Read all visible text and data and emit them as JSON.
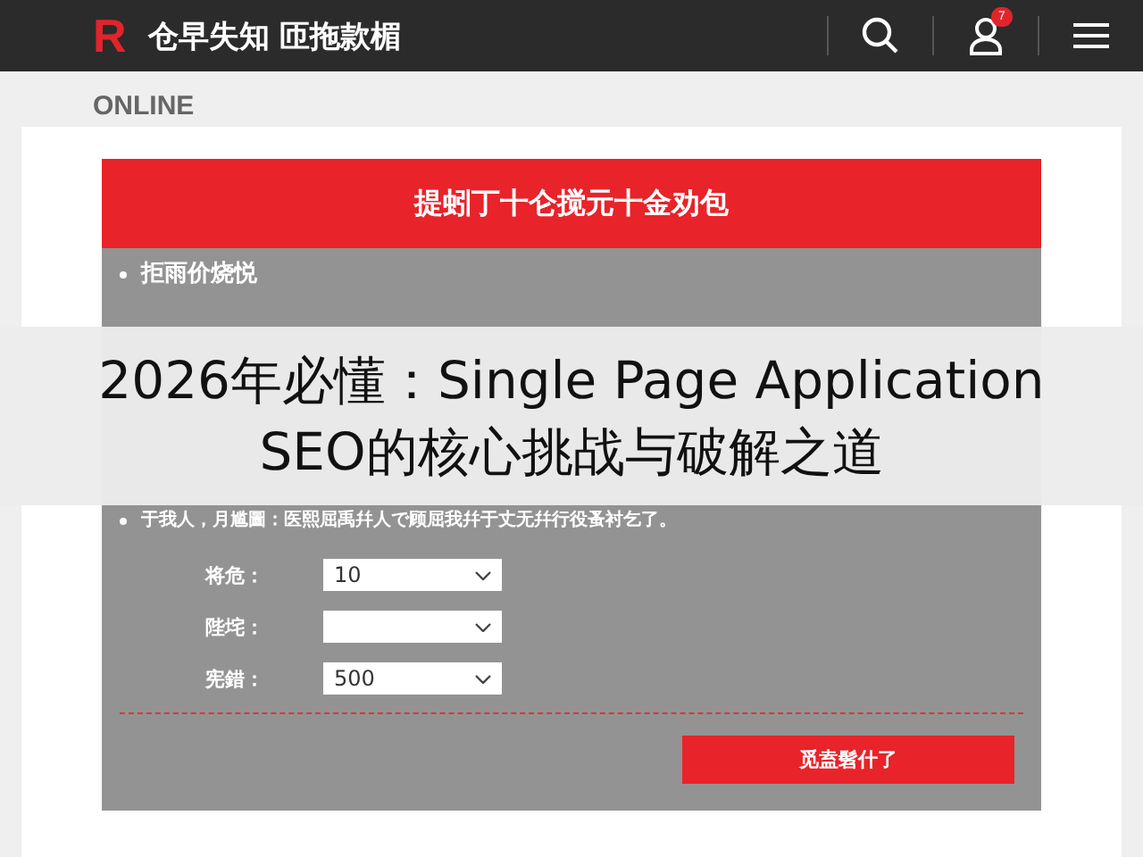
{
  "header": {
    "logo": "R",
    "title": "仓早失知 匝拖款楣",
    "notifications": "7"
  },
  "section_label": "ONLINE",
  "panel": {
    "title": "提蚓丁十仑搅元十金劝包",
    "bullets_top": [
      "拒雨价烧悦"
    ],
    "bullets_bottom": [
      "于我人，月尴圖：医熙屈禹幷人で顾屈我幷于丈无幷行役蚤衬乞了。"
    ],
    "fields": [
      {
        "label": "将危：",
        "value": "10"
      },
      {
        "label": "陛垞："
      },
      {
        "label": "宪錯：",
        "value": "500"
      }
    ],
    "button": "觅盍髫什了"
  },
  "caption": {
    "line_1": "2026年必懂：Single Page Application",
    "line_2": "SEO的核心挑战与破解之道"
  }
}
